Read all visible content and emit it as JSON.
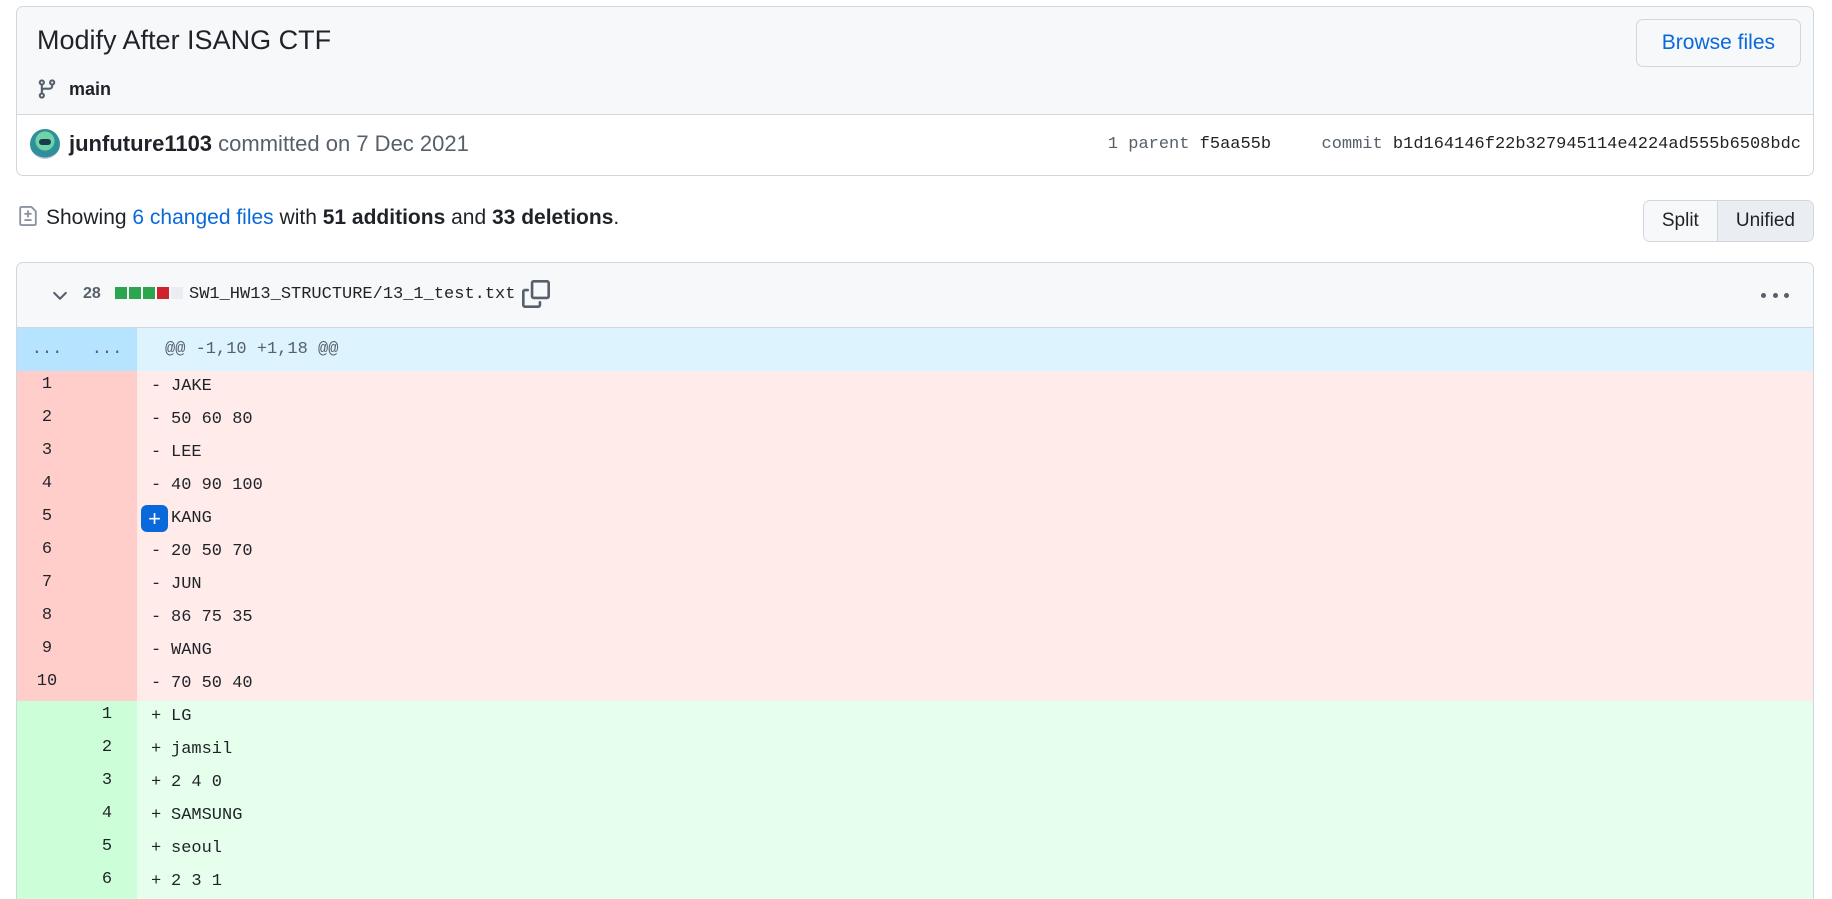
{
  "commit": {
    "title": "Modify After ISANG CTF",
    "branch": "main",
    "browse_label": "Browse files",
    "author": "junfuture1103",
    "committed_text": "committed on 7 Dec 2021",
    "parent_label": "1 parent",
    "parent_sha": "f5aa55b",
    "commit_label": "commit",
    "commit_sha": "b1d164146f22b327945114e4224ad555b6508bdc"
  },
  "summary": {
    "showing": "Showing",
    "changed_files": "6 changed files",
    "with": "with",
    "additions": "51 additions",
    "and": "and",
    "deletions": "33 deletions",
    "period": ".",
    "split_label": "Split",
    "unified_label": "Unified"
  },
  "file": {
    "change_count": "28",
    "path": "SW1_HW13_STRUCTURE/13_1_test.txt",
    "diffstat_colors": [
      "#2da44e",
      "#2da44e",
      "#2da44e",
      "#cf222e",
      "#eaeef2"
    ],
    "hunk": {
      "old": "...",
      "new": "...",
      "text": "@@ -1,10 +1,18 @@"
    },
    "lines": [
      {
        "type": "del",
        "old": "1",
        "new": "",
        "marker": "-",
        "text": "JAKE"
      },
      {
        "type": "del",
        "old": "2",
        "new": "",
        "marker": "-",
        "text": "50 60 80"
      },
      {
        "type": "del",
        "old": "3",
        "new": "",
        "marker": "-",
        "text": "LEE"
      },
      {
        "type": "del",
        "old": "4",
        "new": "",
        "marker": "-",
        "text": "40 90 100"
      },
      {
        "type": "del",
        "old": "5",
        "new": "",
        "marker": "-",
        "text": "KANG",
        "hover": true
      },
      {
        "type": "del",
        "old": "6",
        "new": "",
        "marker": "-",
        "text": "20 50 70"
      },
      {
        "type": "del",
        "old": "7",
        "new": "",
        "marker": "-",
        "text": "JUN"
      },
      {
        "type": "del",
        "old": "8",
        "new": "",
        "marker": "-",
        "text": "86 75 35"
      },
      {
        "type": "del",
        "old": "9",
        "new": "",
        "marker": "-",
        "text": "WANG"
      },
      {
        "type": "del",
        "old": "10",
        "new": "",
        "marker": "-",
        "text": "70 50 40"
      },
      {
        "type": "add",
        "old": "",
        "new": "1",
        "marker": "+",
        "text": "LG"
      },
      {
        "type": "add",
        "old": "",
        "new": "2",
        "marker": "+",
        "text": "jamsil"
      },
      {
        "type": "add",
        "old": "",
        "new": "3",
        "marker": "+",
        "text": "2 4 0"
      },
      {
        "type": "add",
        "old": "",
        "new": "4",
        "marker": "+",
        "text": "SAMSUNG"
      },
      {
        "type": "add",
        "old": "",
        "new": "5",
        "marker": "+",
        "text": "seoul"
      },
      {
        "type": "add",
        "old": "",
        "new": "6",
        "marker": "+",
        "text": "2 3 1"
      }
    ]
  }
}
